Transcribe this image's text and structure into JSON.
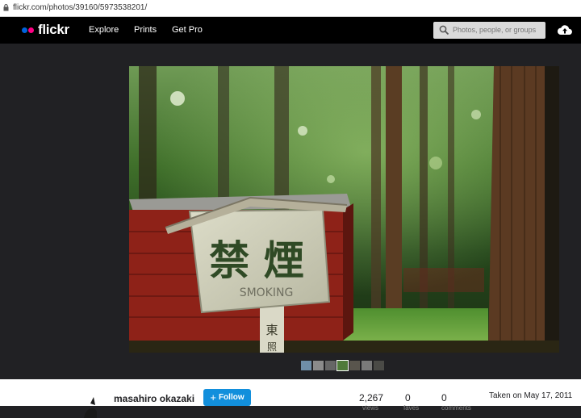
{
  "browser": {
    "url": "flickr.com/photos/39160/5973538201/"
  },
  "nav": {
    "logo_text": "flickr",
    "links": [
      "Explore",
      "Prints",
      "Get Pro"
    ],
    "search_placeholder": "Photos, people, or groups"
  },
  "photo": {
    "sign_kanji": "禁 煙",
    "sign_english": "SMOKING"
  },
  "footer": {
    "author": "masahiro okazaki",
    "follow_label": "Follow",
    "stats": [
      {
        "value": "2,267",
        "label": "views"
      },
      {
        "value": "0",
        "label": "faves"
      },
      {
        "value": "0",
        "label": "comments"
      }
    ],
    "taken": "Taken on May 17, 2011"
  },
  "colors": {
    "brand_blue": "#0063dc",
    "brand_pink": "#ff0084",
    "follow_blue": "#128fdc"
  }
}
